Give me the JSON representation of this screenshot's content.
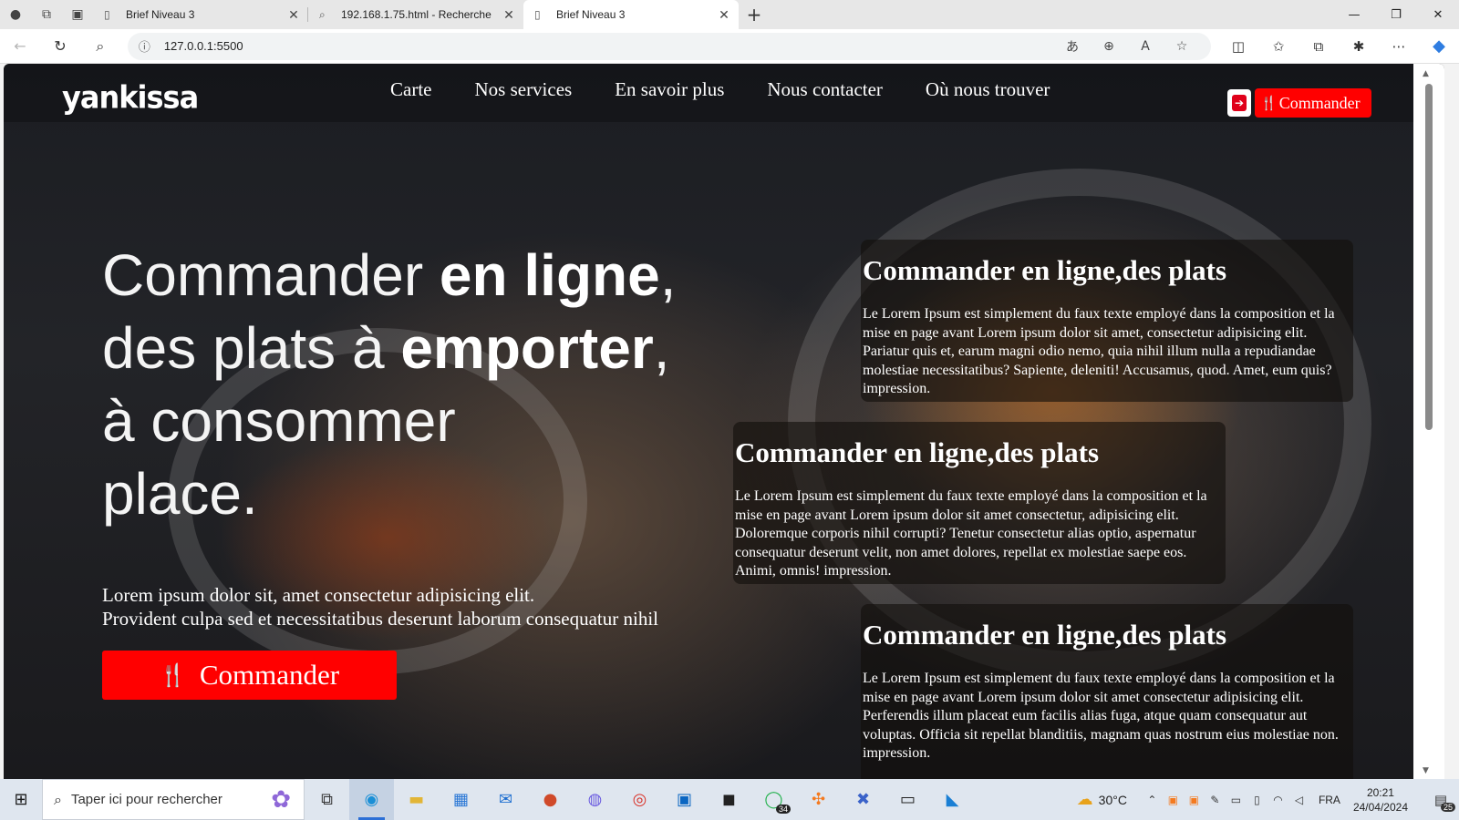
{
  "browser": {
    "tabs": [
      {
        "title": "Brief Niveau 3",
        "active": false,
        "icon": "page-icon"
      },
      {
        "title": "192.168.1.75.html - Recherche",
        "active": false,
        "icon": "search-icon"
      },
      {
        "title": "Brief Niveau 3",
        "active": true,
        "icon": "page-icon"
      }
    ],
    "url": "127.0.0.1:5500"
  },
  "site": {
    "logo": "yankissa",
    "nav": [
      "Carte",
      "Nos services",
      "En savoir plus",
      "Nous contacter",
      "Où nous trouver"
    ],
    "header_button": "Commander",
    "hero": {
      "line1_light": "Commander ",
      "line1_bold": "en ligne",
      "line1_end": ",",
      "line2_light": "des plats à ",
      "line2_bold": "emporter",
      "line2_end": ",",
      "line3": "à consommer",
      "line4": "place.",
      "text_line1": "Lorem ipsum dolor sit, amet consectetur adipisicing elit.",
      "text_line2": "Provident culpa sed et necessitatibus deserunt laborum consequatur nihil",
      "button": "Commander"
    },
    "cards": [
      {
        "title": "Commander en ligne,des plats",
        "text": "Le Lorem Ipsum est simplement du faux texte employé dans la composition et la mise en page avant Lorem ipsum dolor sit amet, consectetur adipisicing elit. Pariatur quis et, earum magni odio nemo, quia nihil illum nulla a repudiandae molestiae necessitatibus? Sapiente, deleniti! Accusamus, quod. Amet, eum quis? impression."
      },
      {
        "title": "Commander en ligne,des plats",
        "text": "Le Lorem Ipsum est simplement du faux texte employé dans la composition et la mise en page avant Lorem ipsum dolor sit amet consectetur, adipisicing elit. Doloremque corporis nihil corrupti? Tenetur consectetur alias optio, aspernatur consequatur deserunt velit, non amet dolores, repellat ex molestiae saepe eos. Animi, omnis! impression."
      },
      {
        "title": "Commander en ligne,des plats",
        "text": "Le Lorem Ipsum est simplement du faux texte employé dans la composition et la mise en page avant Lorem ipsum dolor sit amet consectetur adipisicing elit. Perferendis illum placeat eum facilis alias fuga, atque quam consequatur aut voluptas. Officia sit repellat blanditiis, magnam quas nostrum eius molestiae non. impression."
      }
    ]
  },
  "taskbar": {
    "search_placeholder": "Taper ici pour rechercher",
    "whatsapp_badge": "34",
    "weather": "30°C",
    "language": "FRA",
    "time": "20:21",
    "date": "24/04/2024",
    "notifications": "25"
  },
  "colors": {
    "accent_red": "#ff0000",
    "edge_blue": "#2b6fd6"
  }
}
